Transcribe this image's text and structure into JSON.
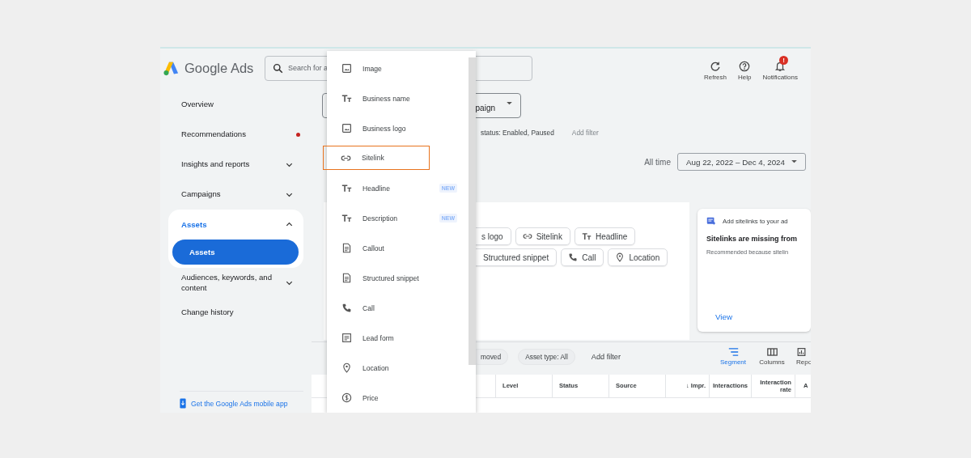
{
  "header": {
    "logo": "Google Ads",
    "search": {
      "placeholder": "Search for a"
    },
    "actions": [
      {
        "kind": "refresh",
        "label": "Refresh"
      },
      {
        "kind": "help",
        "label": "Help"
      },
      {
        "kind": "bell",
        "label": "Notifications",
        "badge": "!"
      }
    ]
  },
  "sidebar": {
    "items": [
      {
        "label": "Overview",
        "dot": false,
        "selected": false
      },
      {
        "label": "Recommendations",
        "dot": true,
        "selected": false
      },
      {
        "label": "Insights and reports",
        "dot": false,
        "expanded": false,
        "selected": false
      },
      {
        "label": "Campaigns",
        "dot": false,
        "expanded": false,
        "selected": false
      },
      {
        "label": "Assets",
        "dot": false,
        "expanded": true,
        "selected": true,
        "children": [
          {
            "label": "Assets",
            "selected": true
          }
        ]
      },
      {
        "label": "Audiences, keywords, and content",
        "dot": false,
        "expanded": false,
        "selected": false
      },
      {
        "label": "Change history",
        "dot": false,
        "selected": false
      }
    ],
    "footer_link": "Get the Google Ads mobile app"
  },
  "asset_menu": {
    "items": [
      {
        "kind": "image",
        "label": "Image",
        "highlighted": false
      },
      {
        "kind": "text",
        "label": "Business name",
        "highlighted": false
      },
      {
        "kind": "image",
        "label": "Business logo",
        "highlighted": false
      },
      {
        "kind": "link",
        "label": "Sitelink",
        "highlighted": true
      },
      {
        "kind": "text",
        "label": "Headline",
        "badge": "NEW",
        "highlighted": false
      },
      {
        "kind": "text",
        "label": "Description",
        "badge": "NEW",
        "highlighted": false
      },
      {
        "kind": "note",
        "label": "Callout",
        "highlighted": false
      },
      {
        "kind": "note",
        "label": "Structured snippet",
        "highlighted": false
      },
      {
        "kind": "phone",
        "label": "Call",
        "highlighted": false
      },
      {
        "kind": "form",
        "label": "Lead form",
        "highlighted": false
      },
      {
        "kind": "place",
        "label": "Location",
        "highlighted": false
      },
      {
        "kind": "price",
        "label": "Price",
        "highlighted": false
      }
    ]
  },
  "campaign_select": {
    "value": "paign"
  },
  "filters": [
    {
      "kind": "text",
      "label": "status: Enabled, Paused"
    },
    {
      "kind": "link",
      "label": "Add filter"
    }
  ],
  "date_range": {
    "label": "All time",
    "value": "Aug 22, 2022 – Dec 4, 2024"
  },
  "asset_chips": [
    [
      {
        "kind": "none",
        "label": "s logo"
      },
      {
        "kind": "link",
        "label": "Sitelink"
      },
      {
        "kind": "text",
        "label": "Headline"
      }
    ],
    [
      {
        "kind": "none",
        "label": "Structured snippet"
      },
      {
        "kind": "phone",
        "label": "Call"
      },
      {
        "kind": "place",
        "label": "Location"
      }
    ]
  ],
  "recommendation": {
    "title": "Add sitelinks to your ad",
    "heading": "Sitelinks are missing from",
    "body": "Recommended because sitelin",
    "action": "View"
  },
  "table_toolbar": {
    "chips": [
      "moved",
      "Asset type: All"
    ],
    "add_filter": "Add filter",
    "tools": [
      {
        "kind": "segment",
        "label": "Segment",
        "selected": true
      },
      {
        "kind": "columns",
        "label": "Columns",
        "selected": false
      },
      {
        "kind": "reports",
        "label": "Repo",
        "selected": false
      }
    ]
  },
  "table": {
    "columns": [
      "",
      "Level",
      "Status",
      "Source",
      "↓ Impr.",
      "Interactions",
      "Interaction rate",
      "A"
    ]
  }
}
